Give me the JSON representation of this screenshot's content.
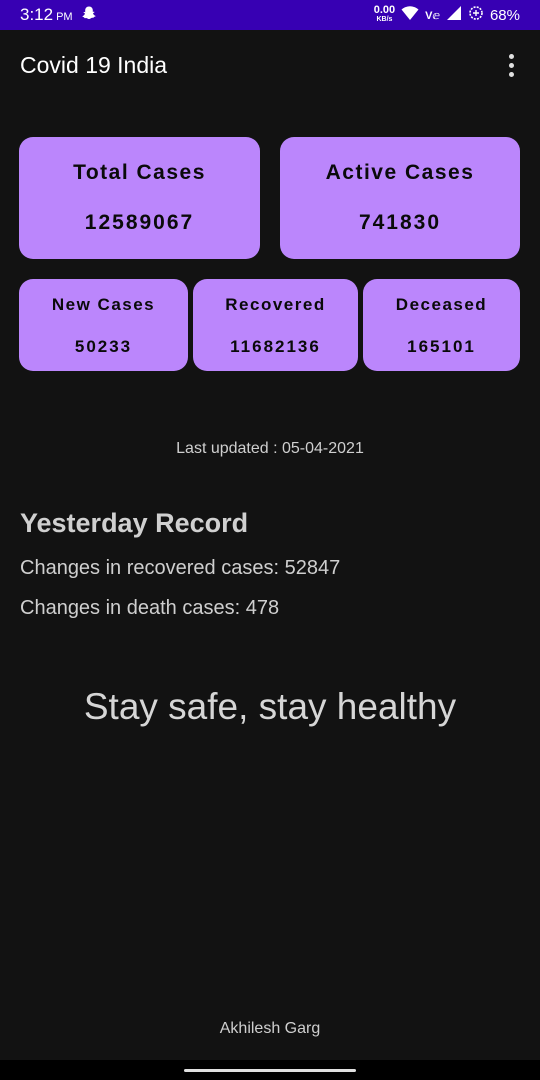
{
  "status_bar": {
    "time": "3:12",
    "ampm": "PM",
    "net_speed": "0.00",
    "net_unit": "KB/s",
    "volte": "V",
    "battery": "68%",
    "icons": [
      "snapchat-icon",
      "wifi-icon",
      "signal-icon",
      "battery-saver-icon"
    ]
  },
  "app_bar": {
    "title": "Covid 19 India",
    "menu_icon": "overflow-menu-icon"
  },
  "cards": {
    "total": {
      "label": "Total Cases",
      "value": "12589067"
    },
    "active": {
      "label": "Active Cases",
      "value": "741830"
    },
    "new": {
      "label": "New Cases",
      "value": "50233"
    },
    "recovered": {
      "label": "Recovered",
      "value": "11682136"
    },
    "deceased": {
      "label": "Deceased",
      "value": "165101"
    }
  },
  "last_updated": "Last updated : 05-04-2021",
  "yesterday": {
    "title": "Yesterday Record",
    "recovered_line": "Changes in recovered cases: 52847",
    "death_line": "Changes in death cases: 478"
  },
  "tagline": "Stay safe, stay healthy",
  "author": "Akhilesh Garg",
  "colors": {
    "status_bar": "#3700b3",
    "background": "#121212",
    "card": "#bb86fc"
  }
}
